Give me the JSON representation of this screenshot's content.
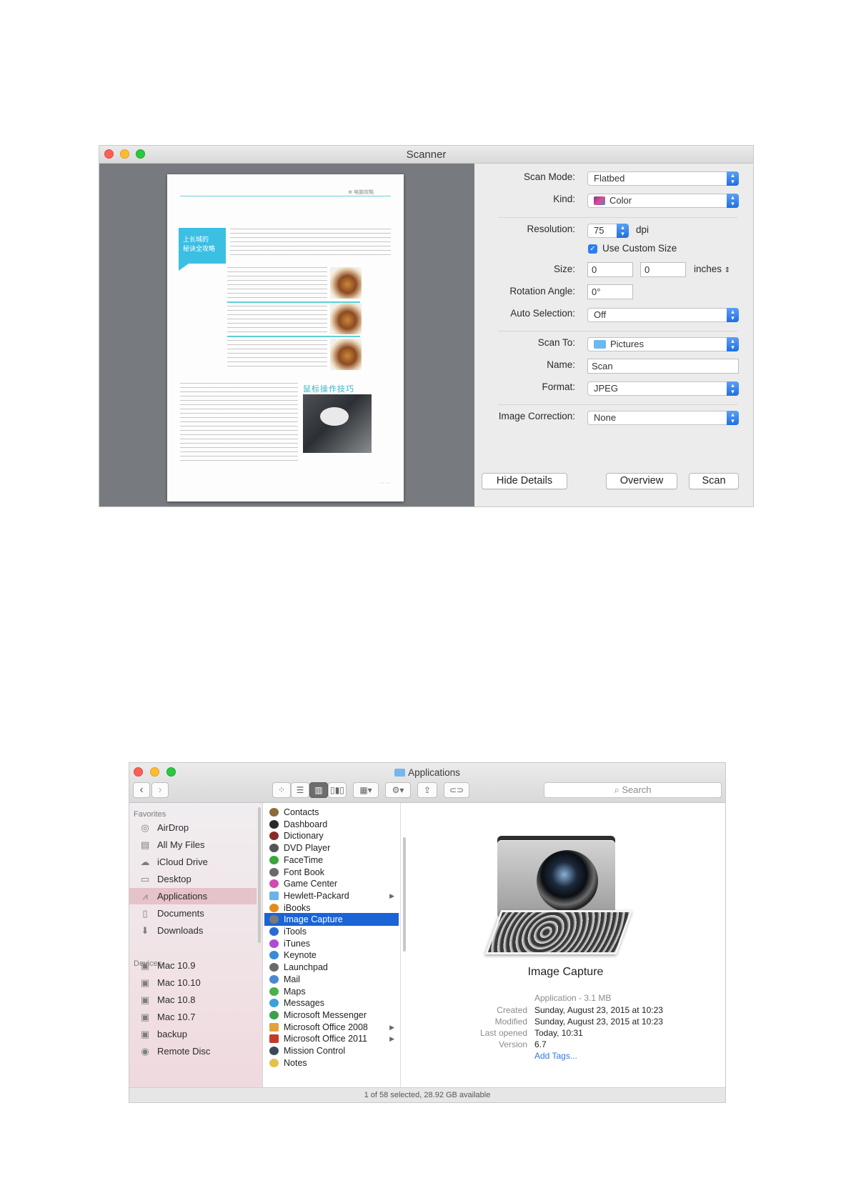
{
  "scanner": {
    "title": "Scanner",
    "preview": {
      "header_text": "⊕ 电脑攻略",
      "heading_lines": [
        "上长城的",
        "秘诀全攻略"
      ],
      "section_title": "鼠标操作技巧",
      "footer_text": "◦ ◦ ◦ ◦"
    },
    "form": {
      "scan_mode": {
        "label": "Scan Mode:",
        "value": "Flatbed"
      },
      "kind": {
        "label": "Kind:",
        "value": "Color"
      },
      "resolution": {
        "label": "Resolution:",
        "value": "75",
        "unit": "dpi"
      },
      "use_custom_size": {
        "label": "Use Custom Size",
        "checked": true
      },
      "size": {
        "label": "Size:",
        "width": "0",
        "height": "0",
        "unit": "inches"
      },
      "rotation": {
        "label": "Rotation Angle:",
        "value": "0°"
      },
      "auto_selection": {
        "label": "Auto Selection:",
        "value": "Off"
      },
      "scan_to": {
        "label": "Scan To:",
        "value": "Pictures"
      },
      "name": {
        "label": "Name:",
        "value": "Scan"
      },
      "format": {
        "label": "Format:",
        "value": "JPEG"
      },
      "image_correction": {
        "label": "Image Correction:",
        "value": "None"
      }
    },
    "buttons": {
      "hide_details": "Hide Details",
      "overview": "Overview",
      "scan": "Scan"
    }
  },
  "finder": {
    "title": "Applications",
    "toolbar": {
      "back": "‹",
      "forward": "›",
      "search_placeholder": "Search"
    },
    "sidebar": {
      "favorites_header": "Favorites",
      "favorites": [
        {
          "label": "AirDrop",
          "icon": "airdrop-icon"
        },
        {
          "label": "All My Files",
          "icon": "all-files-icon"
        },
        {
          "label": "iCloud Drive",
          "icon": "cloud-icon"
        },
        {
          "label": "Desktop",
          "icon": "desktop-icon"
        },
        {
          "label": "Applications",
          "icon": "applications-icon"
        },
        {
          "label": "Documents",
          "icon": "documents-icon"
        },
        {
          "label": "Downloads",
          "icon": "downloads-icon"
        }
      ],
      "devices_header": "Devices",
      "devices": [
        {
          "label": "Mac 10.9",
          "icon": "disk-icon"
        },
        {
          "label": "Mac 10.10",
          "icon": "disk-icon"
        },
        {
          "label": "Mac 10.8",
          "icon": "disk-icon"
        },
        {
          "label": "Mac 10.7",
          "icon": "disk-icon"
        },
        {
          "label": "backup",
          "icon": "disk-icon"
        },
        {
          "label": "Remote Disc",
          "icon": "disc-icon"
        }
      ]
    },
    "apps": [
      {
        "label": "Contacts",
        "color": "#8a6a3c"
      },
      {
        "label": "Dashboard",
        "color": "#2a2a2a"
      },
      {
        "label": "Dictionary",
        "color": "#8b2a2a"
      },
      {
        "label": "DVD Player",
        "color": "#555555"
      },
      {
        "label": "FaceTime",
        "color": "#3aa53a"
      },
      {
        "label": "Font Book",
        "color": "#6a6a6a"
      },
      {
        "label": "Game Center",
        "color": "#d14ab0"
      },
      {
        "label": "Hewlett-Packard",
        "color": "#6cb2ea",
        "folder": true
      },
      {
        "label": "iBooks",
        "color": "#e48a1e"
      },
      {
        "label": "Image Capture",
        "color": "#7a7a7a"
      },
      {
        "label": "iTools",
        "color": "#2a6ad6"
      },
      {
        "label": "iTunes",
        "color": "#b04ad6"
      },
      {
        "label": "Keynote",
        "color": "#3a8ad6"
      },
      {
        "label": "Launchpad",
        "color": "#6a6a6a"
      },
      {
        "label": "Mail",
        "color": "#4a88d6"
      },
      {
        "label": "Maps",
        "color": "#4ab04a"
      },
      {
        "label": "Messages",
        "color": "#3aa0e0"
      },
      {
        "label": "Microsoft Messenger",
        "color": "#3aa04a"
      },
      {
        "label": "Microsoft Office 2008",
        "color": "#e2a23a",
        "folder": true
      },
      {
        "label": "Microsoft Office 2011",
        "color": "#c23a2a",
        "folder": true
      },
      {
        "label": "Mission Control",
        "color": "#3a4a5a"
      },
      {
        "label": "Notes",
        "color": "#e2c24a"
      }
    ],
    "selected_app": "Image Capture",
    "info": {
      "name": "Image Capture",
      "kind": "Application - 3.1 MB",
      "created_label": "Created",
      "created": "Sunday, August 23, 2015 at 10:23",
      "modified_label": "Modified",
      "modified": "Sunday, August 23, 2015 at 10:23",
      "last_opened_label": "Last opened",
      "last_opened": "Today, 10:31",
      "version_label": "Version",
      "version": "6.7",
      "add_tags": "Add Tags..."
    },
    "status": "1 of 58 selected, 28.92 GB available"
  }
}
